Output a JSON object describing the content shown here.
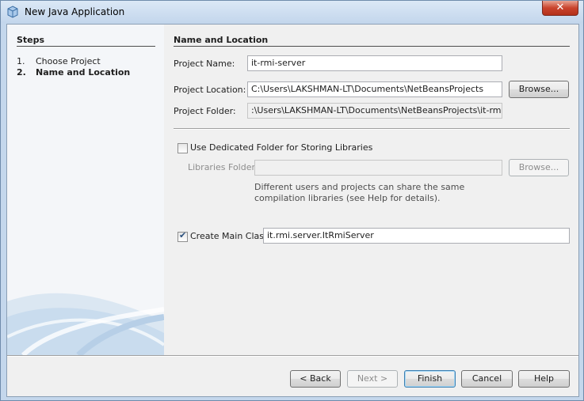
{
  "window": {
    "title": "New Java Application",
    "close_label": "✕"
  },
  "steps": {
    "title": "Steps",
    "items": [
      {
        "num": "1.",
        "label": "Choose Project",
        "current": false
      },
      {
        "num": "2.",
        "label": "Name and Location",
        "current": true
      }
    ]
  },
  "section": {
    "title": "Name and Location"
  },
  "form": {
    "project_name": {
      "label": "Project Name:",
      "value": "it-rmi-server"
    },
    "project_location": {
      "label": "Project Location:",
      "value": "C:\\Users\\LAKSHMAN-LT\\Documents\\NetBeansProjects",
      "browse": "Browse..."
    },
    "project_folder": {
      "label": "Project Folder:",
      "value": ":\\Users\\LAKSHMAN-LT\\Documents\\NetBeansProjects\\it-rmi-server"
    },
    "dedicated_folder": {
      "label": "Use Dedicated Folder for Storing Libraries",
      "checked": false
    },
    "libraries_folder": {
      "label": "Libraries Folder:",
      "value": "",
      "browse": "Browse..."
    },
    "libraries_info": "Different users and projects can share the same compilation libraries (see Help for details).",
    "main_class": {
      "label": "Create Main Class",
      "checked": true,
      "value": "it.rmi.server.ItRmiServer"
    }
  },
  "buttons": {
    "back": "< Back",
    "next": "Next >",
    "finish": "Finish",
    "cancel": "Cancel",
    "help": "Help"
  },
  "colors": {
    "frame": "#c4d7ec",
    "close": "#c9442d",
    "panel": "#f0f0f0"
  }
}
